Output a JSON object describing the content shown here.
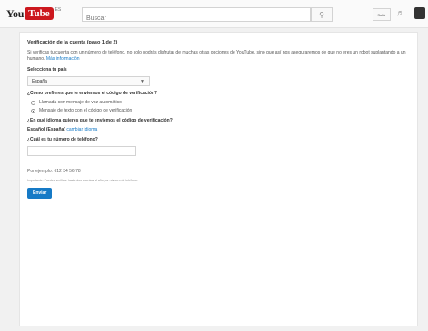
{
  "header": {
    "logo_you": "You",
    "logo_tube": "Tube",
    "logo_country": "ES",
    "search_placeholder": "Buscar",
    "search_icon": "magnifier-icon",
    "upload_label": "Subir",
    "bell_icon": "bell-icon",
    "avatar_icon": "avatar"
  },
  "form": {
    "title": "Verificación de la cuenta (paso 1 de 2)",
    "intro_text": "Si verificas tu cuenta con un número de teléfono, no solo podrás disfrutar de muchas otras opciones de YouTube, sino que así nos aseguraremos de que no eres un robot suplantando a un humano.",
    "intro_link": "Más información",
    "country_label": "Selecciona tu país",
    "country_value": "España",
    "method_label": "¿Cómo prefieres que te enviemos el código de verificación?",
    "method_options": [
      {
        "label": "Llamada con mensaje de voz automático",
        "checked": false
      },
      {
        "label": "Mensaje de texto con el código de verificación",
        "checked": true
      }
    ],
    "language_label": "¿En qué idioma quieres que te enviemos el código de verificación?",
    "language_value": "Español (España)",
    "language_change": "cambiar idioma",
    "phone_label": "¿Cuál es tu número de teléfono?",
    "phone_value": "",
    "example": "Por ejemplo: 612 34 56 78",
    "note": "Importante: Puedes verificar hasta dos cuentas al año por número de teléfono.",
    "submit_label": "Enviar"
  }
}
